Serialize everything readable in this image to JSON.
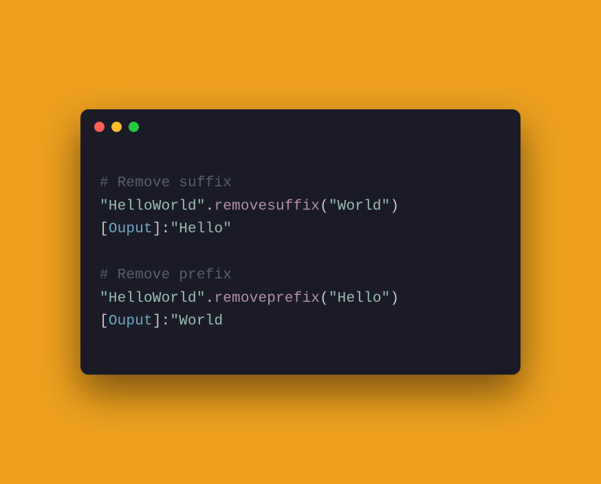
{
  "code": {
    "line1_comment": "# Remove suffix",
    "line2_str1": "\"HelloWorld\"",
    "line2_dot": ".",
    "line2_method": "removesuffix",
    "line2_paren_open": "(",
    "line2_arg": "\"World\"",
    "line2_paren_close": ")",
    "line3_bracket_open": "[",
    "line3_label": "Ouput",
    "line3_bracket_close": "]",
    "line3_colon": ":",
    "line3_result": "\"Hello\"",
    "line4_comment": "# Remove prefix",
    "line5_str1": "\"HelloWorld\"",
    "line5_dot": ".",
    "line5_method": "removeprefix",
    "line5_paren_open": "(",
    "line5_arg": "\"Hello\"",
    "line5_paren_close": ")",
    "line6_bracket_open": "[",
    "line6_label": "Ouput",
    "line6_bracket_close": "]",
    "line6_colon": ":",
    "line6_result": "\"World"
  }
}
